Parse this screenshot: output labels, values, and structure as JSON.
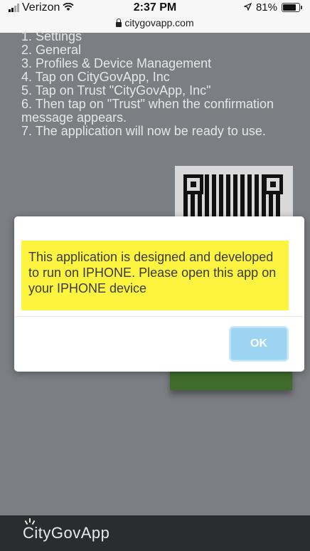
{
  "status_bar": {
    "carrier": "Verizon",
    "time": "2:37 PM",
    "battery": "81%",
    "url": "citygovapp.com"
  },
  "instructions": [
    "1. Settings",
    "2. General",
    "3. Profiles & Device Management",
    "4. Tap on CityGovApp, Inc",
    "5. Tap on Trust \"CityGovApp, Inc\"",
    "6. Then tap on \"Trust\" when the confirmation\nmessage appears.",
    "7. The application will now be ready to use."
  ],
  "modal": {
    "message": "This application is designed and developed to run on IPHONE. Please open this app on your IPHONE device",
    "ok_label": "OK"
  },
  "footer": {
    "brand": "CityGovApp"
  },
  "colors": {
    "overlay": "#7b7e82",
    "message_bg": "#fcf43e",
    "ok_button": "#9dd4f2",
    "footer_bg": "#2b2c2e",
    "green_button": "#3f6b2d"
  },
  "icons": [
    "signal-icon",
    "wifi-icon",
    "location-arrow-icon",
    "battery-icon",
    "lock-icon",
    "qr-code-icon",
    "brand-logo-icon"
  ]
}
